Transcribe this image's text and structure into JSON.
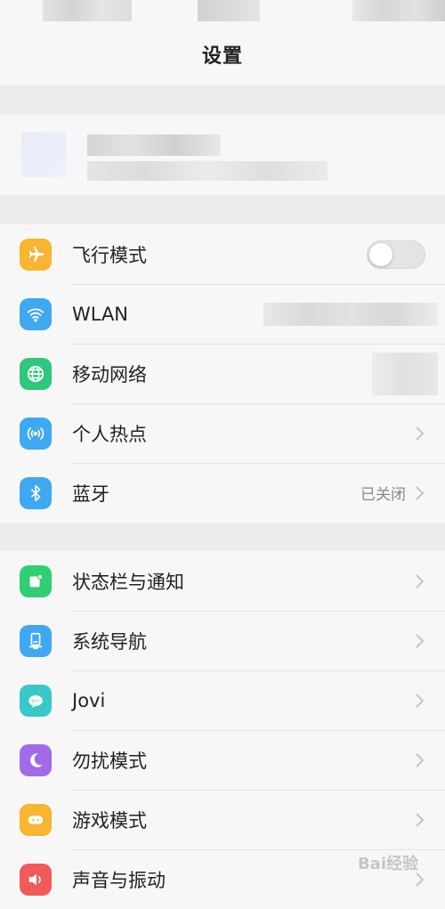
{
  "header": {
    "title": "设置"
  },
  "colors": {
    "airplane": "#f8b530",
    "wlan": "#3ea8f2",
    "mobile": "#2fc77a",
    "hotspot": "#3ea8f2",
    "bluetooth": "#3ea8f2",
    "statusbar": "#2fcf73",
    "nav": "#3ea8f2",
    "jovi": "#38c8c8",
    "dnd": "#a36ae8",
    "game": "#f8b530",
    "sound": "#f25a5a"
  },
  "network_section": {
    "items": [
      {
        "label": "飞行模式",
        "icon": "airplane-icon",
        "control": "toggle",
        "toggle_on": false
      },
      {
        "label": "WLAN",
        "icon": "wifi-icon",
        "control": "blurred-value"
      },
      {
        "label": "移动网络",
        "icon": "globe-icon",
        "control": "blurred-value"
      },
      {
        "label": "个人热点",
        "icon": "hotspot-icon",
        "control": "chevron"
      },
      {
        "label": "蓝牙",
        "icon": "bluetooth-icon",
        "control": "chevron",
        "value": "已关闭"
      }
    ]
  },
  "system_section": {
    "items": [
      {
        "label": "状态栏与通知",
        "icon": "notification-icon",
        "control": "chevron"
      },
      {
        "label": "系统导航",
        "icon": "navigation-icon",
        "control": "chevron"
      },
      {
        "label": "Jovi",
        "icon": "jovi-icon",
        "control": "chevron"
      },
      {
        "label": "勿扰模式",
        "icon": "moon-icon",
        "control": "chevron"
      },
      {
        "label": "游戏模式",
        "icon": "gamepad-icon",
        "control": "chevron"
      },
      {
        "label": "声音与振动",
        "icon": "speaker-icon",
        "control": "chevron"
      }
    ]
  },
  "watermark": "Bai经验"
}
